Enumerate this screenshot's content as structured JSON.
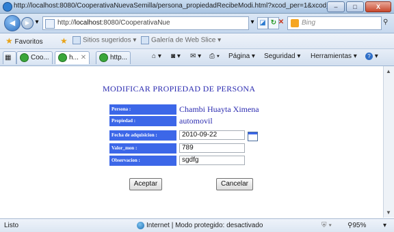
{
  "window": {
    "title": "http://localhost:8080/CooperativaNuevaSemilla/persona_propiedadRecibeModi.html?xcod_per=1&xcod_-...",
    "buttons": {
      "min": "–",
      "max": "□",
      "close": "X"
    }
  },
  "addressbar": {
    "url_prefix": "http://",
    "url_host": "localhost",
    "url_rest": ":8080/CooperativaNue",
    "search_placeholder": "Bing",
    "back_icon": "back-arrow-icon",
    "forward_icon": "forward-arrow-icon"
  },
  "favorites": {
    "label": "Favoritos",
    "suggested": "Sitios sugeridos ▾",
    "gallery": "Galería de Web Slice ▾"
  },
  "tabs": [
    {
      "label": "Coo..."
    },
    {
      "label": "h..."
    },
    {
      "label": "http..."
    }
  ],
  "commandbar": {
    "page": "Página ▾",
    "security": "Seguridad ▾",
    "tools": "Herramientas ▾"
  },
  "form": {
    "title": "MODIFICAR PROPIEDAD DE PERSONA",
    "persona_label": "Persona :",
    "persona_value": "Chambi Huayta Ximena",
    "propiedad_label": "Propiedad :",
    "propiedad_value": "automovil",
    "fecha_label": "Fecha de adquisicion :",
    "fecha_value": "2010-09-22",
    "valor_label": "Valor_mon :",
    "valor_value": "789",
    "observacion_label": "Observacion :",
    "observacion_value": "sgdfg",
    "accept_label": "Aceptar",
    "cancel_label": "Cancelar"
  },
  "status": {
    "left": "Listo",
    "zone": "Internet | Modo protegido: desactivado",
    "zoom": "95%"
  },
  "colors": {
    "label_bg": "#3c67e8",
    "heading": "#2b2bb0"
  }
}
